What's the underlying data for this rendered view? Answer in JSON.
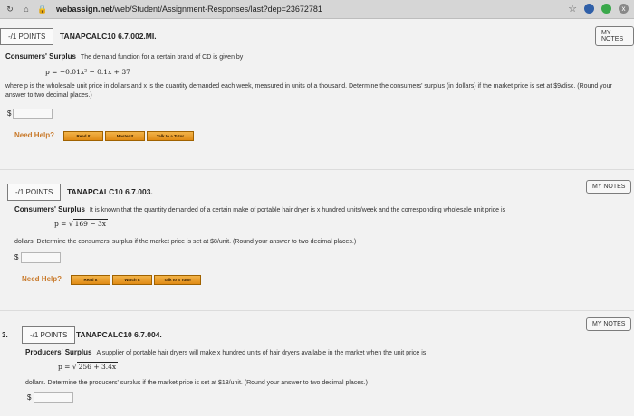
{
  "browser": {
    "url_domain": "webassign.net",
    "url_path": "/web/Student/Assignment-Responses/last?dep=23672781",
    "close_label": "x"
  },
  "questions": [
    {
      "number": "",
      "points": "-/1 POINTS",
      "code": "TANAPCALC10 6.7.002.MI.",
      "notes": "MY NOTES",
      "topic": "Consumers' Surplus",
      "intro": "The demand function for a certain brand of CD is given by",
      "formula": "p = −0.01x² − 0.1x + 37",
      "body": "where p is the wholesale unit price in dollars and x is the quantity demanded each week, measured in units of a thousand. Determine the consumers' surplus (in dollars) if the market price is set at $9/disc. (Round your answer to two decimal places.)",
      "currency": "$",
      "help_label": "Need Help?",
      "buttons": [
        "Read It",
        "Master It",
        "Talk to a Tutor"
      ]
    },
    {
      "number": "",
      "points": "-/1 POINTS",
      "code": "TANAPCALC10 6.7.003.",
      "notes": "MY NOTES",
      "topic": "Consumers' Surplus",
      "intro": "It is known that the quantity demanded of a certain make of portable hair dryer is x hundred units/week and the corresponding wholesale unit price is",
      "formula_lhs": "p = ",
      "formula_sqrt": "169 − 3x",
      "body": "dollars. Determine the consumers' surplus if the market price is set at $8/unit. (Round your answer to two decimal places.)",
      "currency": "$",
      "help_label": "Need Help?",
      "buttons": [
        "Read It",
        "Watch It",
        "Talk to a Tutor"
      ]
    },
    {
      "number": "3.",
      "points": "-/1 POINTS",
      "code": "TANAPCALC10 6.7.004.",
      "notes": "MY NOTES",
      "topic": "Producers' Surplus",
      "intro": "A supplier of portable hair dryers will make x hundred units of hair dryers available in the market when the unit price is",
      "formula_lhs": "p = ",
      "formula_sqrt": "256 + 3.4x",
      "body": "dollars. Determine the producers' surplus if the market price is set at $18/unit. (Round your answer to two decimal places.)",
      "currency": "$"
    }
  ]
}
